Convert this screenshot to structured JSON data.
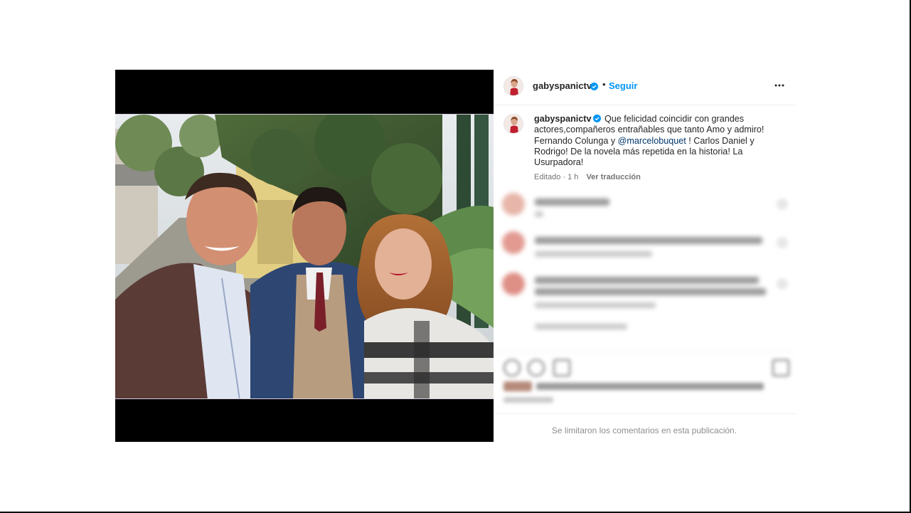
{
  "post": {
    "author": "gabyspanictv",
    "follow_label": "Seguir",
    "separator": "•",
    "caption": {
      "text_before_mention": "Que felicidad coincidir con grandes actores,compañeros entrañables que tanto Amo y admiro! Fernando Colunga y ",
      "mention": "@marcelobuquet",
      "text_after_mention": " ! Carlos Daniel y Rodrigo! De la novela más repetida en la historia! La Usurpadora!"
    },
    "edited_label": "Editado · 1 h",
    "translate_label": "Ver traducción",
    "comments_limited_notice": "Se limitaron los comentarios en esta publicación."
  },
  "icons": {
    "verified": "verified-badge-icon",
    "more": "more-options-icon",
    "like": "heart-icon",
    "comment": "comment-icon",
    "share": "share-icon",
    "save": "bookmark-icon"
  },
  "colors": {
    "follow_blue": "#0095f6",
    "mention_blue": "#00376b",
    "verified_blue": "#0095f6",
    "muted_text": "#737373"
  }
}
